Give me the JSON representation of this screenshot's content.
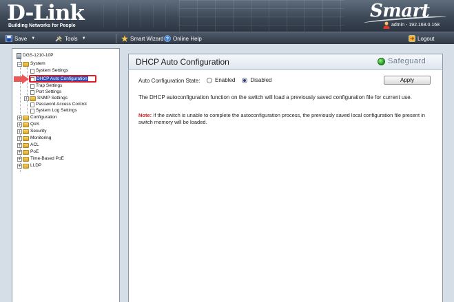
{
  "header": {
    "logo_text": "D-Link",
    "logo_tagline": "Building Networks for People",
    "product_logo": "Smart",
    "user_info": "admin - 192.168.0.168"
  },
  "toolbar": {
    "save_label": "Save",
    "tools_label": "Tools",
    "smart_wizard_label": "Smart Wizard",
    "online_help_label": "Online Help",
    "logout_label": "Logout"
  },
  "tree": {
    "root": "DGS-1210-10P",
    "system": "System",
    "system_settings": "System Settings",
    "dhcp_auto_config": "DHCP Auto Configuration",
    "trap_settings": "Trap Settings",
    "port_settings": "Port Settings",
    "snmp_settings": "SNMP Settings",
    "password_access_control": "Password Access Control",
    "system_log_settings": "System Log Settings",
    "configuration": "Configuration",
    "qos": "QoS",
    "security": "Security",
    "monitoring": "Monitoring",
    "acl": "ACL",
    "poe": "PoE",
    "time_based_poe": "Time-Based PoE",
    "lldp": "LLDP"
  },
  "main": {
    "title": "DHCP Auto Configuration",
    "safeguard_label": "Safeguard",
    "state_label": "Auto Configuration State:",
    "option_enabled": "Enabled",
    "option_disabled": "Disabled",
    "selected_option": "Disabled",
    "apply_label": "Apply",
    "description": "The DHCP autoconfiguration function on the switch will load a previously saved configuration file for current use.",
    "note_label": "Note:",
    "note_text": " If the switch is unable to complete the autoconfiguration process, the previously saved local configuration file present in switch memory will be loaded."
  },
  "colors": {
    "selected_bg": "#2a50b8",
    "highlight_red": "#e31b23",
    "note_red": "#d21a1a",
    "safeguard_green": "#2fa52a"
  }
}
